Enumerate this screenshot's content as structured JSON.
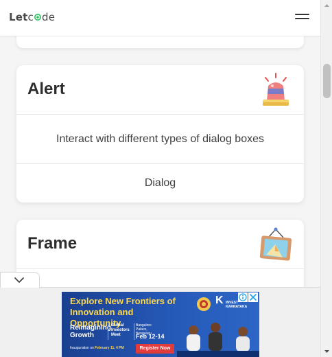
{
  "header": {
    "logo_part1": "Let",
    "logo_part2": "de",
    "menu_icon": "hamburger-menu-icon"
  },
  "cards": {
    "alert": {
      "title": "Alert",
      "icon": "siren-icon",
      "description": "Interact with different types of dialog boxes",
      "link": "Dialog"
    },
    "frame": {
      "title": "Frame",
      "icon": "framed-picture-icon"
    }
  },
  "ad": {
    "headline": "Explore New Frontiers of Innovation and Opportunity",
    "subline": "Reimagining Growth",
    "global": "Global Investors Meet",
    "venue": "Bangalore Palace, Bengaluru",
    "date": "Feb 12-14",
    "inauguration_label": "Inauguration on",
    "inauguration_date": "February 11, 4 PM",
    "register": "Register Now",
    "brand_top": "INVEST",
    "brand_bottom": "KARNATAKA"
  },
  "colors": {
    "logo_accent": "#2dbe60",
    "ad_headline": "#ffd84a",
    "register_button": "#e23b3b"
  }
}
